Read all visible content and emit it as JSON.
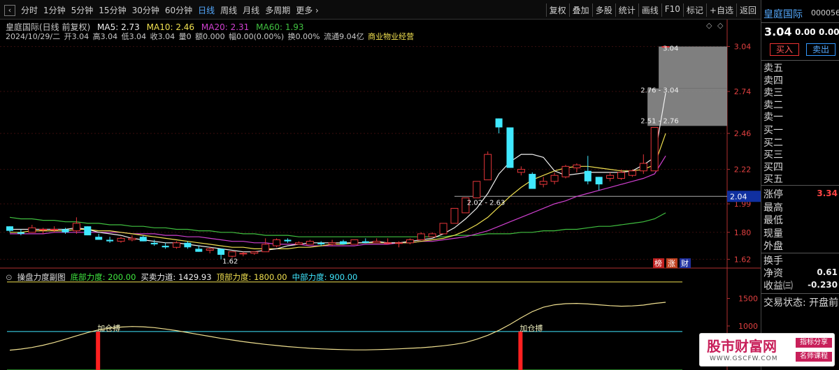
{
  "toolbar": {
    "back": "‹",
    "periods": [
      "分时",
      "1分钟",
      "5分钟",
      "15分钟",
      "30分钟",
      "60分钟",
      "日线",
      "周线",
      "月线",
      "多周期",
      "更多 ›"
    ],
    "active_period": "日线",
    "tools": [
      "复权",
      "叠加",
      "多股",
      "统计",
      "画线",
      "F10",
      "标记",
      "+自选",
      "返回"
    ]
  },
  "title_line": {
    "name": "皇庭国际(日线 前复权)",
    "ma5": "MA5: 2.73",
    "ma10": "MA10: 2.46",
    "ma20": "MA20: 2.31",
    "ma60": "MA60: 1.93"
  },
  "info_line": {
    "date": "2024/10/29/二",
    "open": "开3.04",
    "high": "高3.04",
    "low": "低3.04",
    "close": "收3.04",
    "volume": "量0",
    "amount": "额0.000",
    "amp": "幅0.00(0.00%)",
    "turnover": "换0.00%",
    "float": "流通9.04亿",
    "industry": "商业物业经营"
  },
  "colors": {
    "up": "#e8363a",
    "down": "#40e8ff",
    "ma5": "#f0f0f0",
    "ma10": "#f0e050",
    "ma20": "#d040d0",
    "ma60": "#40c040",
    "axis": "#b03030",
    "grid": "#3a0e0e"
  },
  "price_axis": [
    "3.04",
    "2.74",
    "2.46",
    "2.22",
    "1.99",
    "1.80",
    "1.62"
  ],
  "price_marker": "2.04",
  "sub_axis": [
    "1500",
    "1000"
  ],
  "badges": [
    "榜",
    "涨",
    "财"
  ],
  "chart_data": {
    "type": "candlestick",
    "ylim": [
      1.58,
      3.08
    ],
    "candles": [
      [
        1.84,
        1.84,
        1.8,
        1.81
      ],
      [
        1.8,
        1.82,
        1.78,
        1.79
      ],
      [
        1.8,
        1.85,
        1.8,
        1.83
      ],
      [
        1.82,
        1.83,
        1.79,
        1.82
      ],
      [
        1.82,
        1.84,
        1.8,
        1.82
      ],
      [
        1.82,
        1.83,
        1.79,
        1.8
      ],
      [
        1.81,
        1.9,
        1.79,
        1.86
      ],
      [
        1.84,
        1.84,
        1.78,
        1.78
      ],
      [
        1.77,
        1.79,
        1.75,
        1.75
      ],
      [
        1.75,
        1.77,
        1.73,
        1.74
      ],
      [
        1.74,
        1.77,
        1.73,
        1.76
      ],
      [
        1.75,
        1.78,
        1.74,
        1.76
      ],
      [
        1.77,
        1.78,
        1.74,
        1.74
      ],
      [
        1.73,
        1.75,
        1.71,
        1.72
      ],
      [
        1.71,
        1.73,
        1.69,
        1.7
      ],
      [
        1.7,
        1.74,
        1.69,
        1.73
      ],
      [
        1.73,
        1.74,
        1.69,
        1.7
      ],
      [
        1.69,
        1.71,
        1.67,
        1.67
      ],
      [
        1.68,
        1.7,
        1.66,
        1.69
      ],
      [
        1.69,
        1.69,
        1.62,
        1.65
      ],
      [
        1.64,
        1.67,
        1.63,
        1.67
      ],
      [
        1.66,
        1.67,
        1.64,
        1.66
      ],
      [
        1.66,
        1.67,
        1.65,
        1.67
      ],
      [
        1.67,
        1.76,
        1.67,
        1.72
      ],
      [
        1.71,
        1.76,
        1.7,
        1.75
      ],
      [
        1.75,
        1.76,
        1.73,
        1.74
      ],
      [
        1.72,
        1.74,
        1.72,
        1.73
      ],
      [
        1.72,
        1.75,
        1.72,
        1.74
      ],
      [
        1.73,
        1.74,
        1.71,
        1.72
      ],
      [
        1.72,
        1.75,
        1.71,
        1.73
      ],
      [
        1.74,
        1.75,
        1.72,
        1.72
      ],
      [
        1.72,
        1.75,
        1.72,
        1.75
      ],
      [
        1.74,
        1.76,
        1.73,
        1.73
      ],
      [
        1.73,
        1.76,
        1.73,
        1.74
      ],
      [
        1.73,
        1.76,
        1.72,
        1.73
      ],
      [
        1.73,
        1.74,
        1.7,
        1.73
      ],
      [
        1.73,
        1.76,
        1.72,
        1.75
      ],
      [
        1.75,
        1.8,
        1.75,
        1.79
      ],
      [
        1.77,
        1.8,
        1.77,
        1.79
      ],
      [
        1.79,
        1.86,
        1.79,
        1.86
      ],
      [
        1.86,
        1.96,
        1.86,
        1.96
      ],
      [
        1.93,
        2.03,
        1.93,
        2.03
      ],
      [
        2.03,
        2.14,
        2.03,
        2.14
      ],
      [
        2.15,
        2.34,
        2.15,
        2.32
      ],
      [
        2.56,
        2.56,
        2.46,
        2.5
      ],
      [
        2.5,
        2.5,
        2.23,
        2.23
      ],
      [
        2.2,
        2.24,
        2.18,
        2.22
      ],
      [
        2.19,
        2.2,
        2.09,
        2.09
      ],
      [
        2.12,
        2.17,
        2.1,
        2.14
      ],
      [
        2.14,
        2.2,
        2.12,
        2.18
      ],
      [
        2.17,
        2.25,
        2.16,
        2.24
      ],
      [
        2.23,
        2.26,
        2.2,
        2.25
      ],
      [
        2.21,
        2.31,
        2.12,
        2.14
      ],
      [
        2.17,
        2.17,
        2.08,
        2.12
      ],
      [
        2.16,
        2.2,
        2.14,
        2.18
      ],
      [
        2.16,
        2.22,
        2.15,
        2.2
      ],
      [
        2.18,
        2.22,
        2.17,
        2.21
      ],
      [
        2.21,
        2.32,
        2.19,
        2.26
      ],
      [
        2.21,
        2.5,
        2.21,
        2.5
      ],
      [
        3.04,
        3.04,
        3.04,
        3.04
      ]
    ],
    "ma5": [
      1.82,
      1.82,
      1.82,
      1.82,
      1.82,
      1.82,
      1.83,
      1.82,
      1.8,
      1.79,
      1.78,
      1.76,
      1.75,
      1.74,
      1.73,
      1.73,
      1.72,
      1.71,
      1.7,
      1.69,
      1.68,
      1.67,
      1.67,
      1.68,
      1.69,
      1.71,
      1.72,
      1.73,
      1.73,
      1.73,
      1.73,
      1.73,
      1.73,
      1.74,
      1.73,
      1.73,
      1.74,
      1.75,
      1.76,
      1.79,
      1.83,
      1.89,
      1.96,
      2.06,
      2.19,
      2.27,
      2.32,
      2.32,
      2.3,
      2.21,
      2.18,
      2.19,
      2.2,
      2.2,
      2.2,
      2.2,
      2.21,
      2.25,
      2.3,
      2.73
    ],
    "ma10": [
      1.8,
      1.8,
      1.81,
      1.81,
      1.81,
      1.81,
      1.82,
      1.82,
      1.81,
      1.81,
      1.8,
      1.79,
      1.78,
      1.77,
      1.76,
      1.75,
      1.74,
      1.73,
      1.72,
      1.71,
      1.7,
      1.7,
      1.69,
      1.69,
      1.69,
      1.69,
      1.7,
      1.7,
      1.71,
      1.72,
      1.72,
      1.73,
      1.73,
      1.73,
      1.73,
      1.73,
      1.73,
      1.74,
      1.75,
      1.76,
      1.78,
      1.81,
      1.85,
      1.9,
      1.97,
      2.04,
      2.1,
      2.15,
      2.18,
      2.21,
      2.23,
      2.24,
      2.24,
      2.23,
      2.22,
      2.21,
      2.21,
      2.22,
      2.25,
      2.46
    ],
    "ma20": [
      1.79,
      1.79,
      1.79,
      1.79,
      1.8,
      1.8,
      1.8,
      1.8,
      1.8,
      1.8,
      1.8,
      1.79,
      1.79,
      1.79,
      1.78,
      1.78,
      1.77,
      1.77,
      1.76,
      1.75,
      1.74,
      1.74,
      1.73,
      1.73,
      1.72,
      1.72,
      1.72,
      1.71,
      1.71,
      1.71,
      1.71,
      1.71,
      1.72,
      1.72,
      1.72,
      1.73,
      1.73,
      1.74,
      1.74,
      1.75,
      1.76,
      1.77,
      1.79,
      1.81,
      1.84,
      1.87,
      1.9,
      1.93,
      1.96,
      1.99,
      2.01,
      2.04,
      2.06,
      2.08,
      2.1,
      2.12,
      2.14,
      2.16,
      2.19,
      2.31
    ],
    "ma60": [
      1.9,
      1.89,
      1.89,
      1.88,
      1.88,
      1.87,
      1.87,
      1.86,
      1.86,
      1.85,
      1.85,
      1.84,
      1.84,
      1.83,
      1.83,
      1.82,
      1.82,
      1.81,
      1.81,
      1.8,
      1.8,
      1.79,
      1.79,
      1.78,
      1.78,
      1.78,
      1.77,
      1.77,
      1.77,
      1.77,
      1.77,
      1.77,
      1.77,
      1.77,
      1.77,
      1.77,
      1.77,
      1.77,
      1.77,
      1.77,
      1.78,
      1.78,
      1.78,
      1.79,
      1.79,
      1.79,
      1.8,
      1.8,
      1.81,
      1.81,
      1.82,
      1.82,
      1.83,
      1.84,
      1.84,
      1.85,
      1.86,
      1.87,
      1.89,
      1.93
    ],
    "annotations": [
      {
        "label": "1.62",
        "index": 19,
        "price": 1.62
      },
      {
        "label": "2.02 - 2.63",
        "index": 41,
        "price": 2.02
      },
      {
        "label": "2.51 - 2.76",
        "index": 58,
        "price": 2.51
      },
      {
        "label": "2.76 - 3.04",
        "index": 58,
        "price": 2.76
      },
      {
        "label": "3.04",
        "index": 59,
        "price": 3.04
      }
    ],
    "zones": [
      {
        "from": 2.51,
        "to": 2.76
      },
      {
        "from": 2.76,
        "to": 3.04
      }
    ],
    "sub": {
      "title": "操盘力度副图",
      "params": [
        {
          "label": "底部力度: 200.00",
          "color": "#40e840"
        },
        {
          "label": "买卖力道: 1429.93",
          "color": "#f0f0f0"
        },
        {
          "label": "顶部力度: 1800.00",
          "color": "#f0e050"
        },
        {
          "label": "中部力度: 900.00",
          "color": "#40e8ff"
        }
      ],
      "ylim": [
        200,
        1900
      ],
      "levels": [
        1800,
        900,
        200
      ],
      "curve": [
        560,
        580,
        610,
        650,
        700,
        760,
        820,
        880,
        930,
        960,
        980,
        990,
        985,
        970,
        945,
        915,
        880,
        845,
        810,
        775,
        745,
        715,
        690,
        665,
        645,
        625,
        610,
        595,
        585,
        575,
        570,
        565,
        565,
        570,
        575,
        585,
        595,
        605,
        620,
        640,
        665,
        700,
        760,
        830,
        920,
        1030,
        1150,
        1260,
        1340,
        1385,
        1405,
        1410,
        1400,
        1385,
        1370,
        1360,
        1365,
        1380,
        1410,
        1430
      ],
      "signal": {
        "label": "加仓搏",
        "indices": [
          8,
          46
        ]
      }
    }
  },
  "right_panel": {
    "name": "皇庭国际",
    "code": "000056",
    "price": "3.04",
    "change": "0.00",
    "pct": "0.00%",
    "buy": "买入",
    "sell": "卖出",
    "sell_levels": [
      "卖五",
      "卖四",
      "卖三",
      "卖二",
      "卖一"
    ],
    "buy_levels": [
      "买一",
      "买二",
      "买三",
      "买四",
      "买五"
    ],
    "limit_up_label": "涨停",
    "limit_up_value": "3.34",
    "stats": [
      "最高",
      "最低",
      "现量",
      "外盘"
    ],
    "turnover_label": "换手",
    "nav_label": "净资",
    "nav_value": "0.61",
    "eps_label": "收益㈢",
    "eps_value": "-0.230",
    "status": "交易状态: 开盘前"
  },
  "watermark": {
    "title": "股市财富网",
    "url": "WWW.GSCFW.COM",
    "tag1": "指标分享",
    "tag2": "名师课程"
  }
}
